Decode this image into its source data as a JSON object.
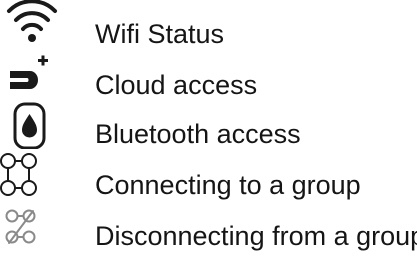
{
  "legend": {
    "items": [
      {
        "icon": "wifi-icon",
        "label": "Wifi Status"
      },
      {
        "icon": "cloud-access-icon",
        "label": "Cloud access"
      },
      {
        "icon": "bluetooth-drop-icon",
        "label": "Bluetooth access"
      },
      {
        "icon": "group-connect-icon",
        "label": "Connecting to a group"
      },
      {
        "icon": "group-disconnect-icon",
        "label": "Disconnecting from a group"
      }
    ]
  }
}
